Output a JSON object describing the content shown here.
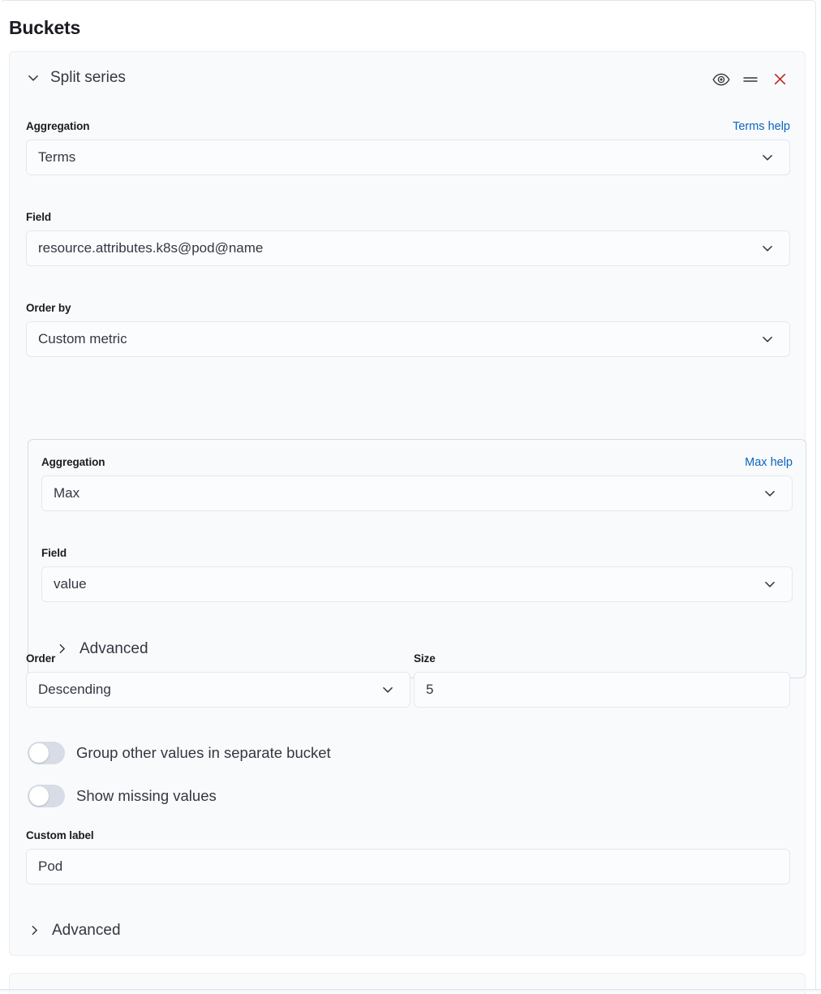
{
  "page": {
    "title": "Buckets"
  },
  "bucket": {
    "header": {
      "title": "Split series",
      "collapse_icon": "chevron-down-icon",
      "visibility_icon": "eye-icon",
      "drag_icon": "drag-handle-icon",
      "remove_icon": "close-icon",
      "accent_link_color": "#0b64c0",
      "remove_color": "#bd271e"
    },
    "aggregation": {
      "label": "Aggregation",
      "help_link": "Terms help",
      "value": "Terms"
    },
    "field": {
      "label": "Field",
      "value": "resource.attributes.k8s@pod@name"
    },
    "order_by": {
      "label": "Order by",
      "value": "Custom metric"
    },
    "custom_metric": {
      "aggregation": {
        "label": "Aggregation",
        "help_link": "Max help",
        "value": "Max"
      },
      "field": {
        "label": "Field",
        "value": "value"
      },
      "advanced": {
        "label": "Advanced",
        "icon": "chevron-right-icon"
      }
    },
    "order": {
      "label": "Order",
      "value": "Descending"
    },
    "size": {
      "label": "Size",
      "value": "5"
    },
    "toggles": [
      {
        "label": "Group other values in separate bucket",
        "checked": false
      },
      {
        "label": "Show missing values",
        "checked": false
      }
    ],
    "custom_label": {
      "label": "Custom label",
      "value": "Pod"
    },
    "advanced": {
      "label": "Advanced",
      "icon": "chevron-right-icon"
    }
  }
}
